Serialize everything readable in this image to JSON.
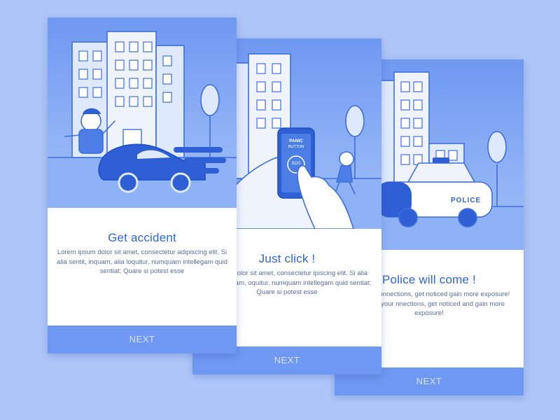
{
  "cards": [
    {
      "title": "Get accident",
      "body": "Lorem ipsum dolor sit amet, consectetur adipiscing elit. Si alia sentit, inquam, alia loquitur, numquam intellegam quid sentiat; Quare si potest esse",
      "next_label": "NEXT"
    },
    {
      "title": "Just click !",
      "body": "m ipsum dolor sit amet, consectetur ipiscing elit. Si alia sentit, inquam, oquitur, numquam intellegam quid sentiat; Quare si potest esse",
      "next_label": "NEXT",
      "phone": {
        "line1": "PANIC",
        "line2": "BUTTON",
        "button": "SOS"
      }
    },
    {
      "title": "Police will come !",
      "body": "ase your connections, get noticed gain more exposure! Increase your nnections, get noticed and gain more exposure!",
      "next_label": "NEXT",
      "car_label": "POLICE"
    }
  ],
  "colors": {
    "background": "#aec6f8",
    "accent": "#2f63d8",
    "next_bar": "#6e98f1"
  }
}
